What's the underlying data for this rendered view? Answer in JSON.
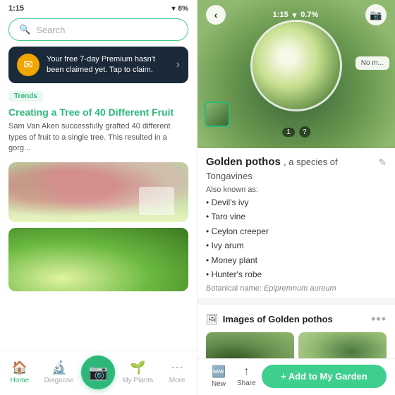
{
  "left": {
    "statusBar": {
      "time": "1:15",
      "battery": "8%"
    },
    "search": {
      "placeholder": "Search"
    },
    "promo": {
      "text": "Your free 7-day Premium hasn't been claimed yet. Tap to claim.",
      "icon": "✉"
    },
    "trends": {
      "badge": "Trends",
      "title": "Creating a Tree of 40 Different Fruit",
      "description": "Sam Van Aken successfully grafted 40 different types of fruit to a single tree. This resulted in a gorg..."
    },
    "nav": {
      "home": "Home",
      "diagnose": "Diagnose",
      "myPlants": "My Plants",
      "more": "More"
    }
  },
  "right": {
    "statusBar": {
      "time": "1:15",
      "battery": "0.7%"
    },
    "plantInfo": {
      "name": "Golden pothos",
      "speciesLabel": ", a species of",
      "family": "Tongavines",
      "alsoKnownAs": "Also known as:",
      "aliases": [
        "Devil's ivy",
        "Taro vine",
        "Ceylon creeper",
        "Ivy arum",
        "Money plant",
        "Hunter's robe"
      ],
      "botanicalLabel": "Botanical name:",
      "botanicalName": "Epipremnum aureum"
    },
    "images": {
      "title": "Images of Golden pothos",
      "icon": "🖼"
    },
    "actions": {
      "new": "New",
      "share": "Share",
      "addToGarden": "+ Add to My Garden"
    },
    "thumbnail": {
      "pageIndicator": "1",
      "questionMark": "?"
    },
    "noMatch": "No m..."
  }
}
